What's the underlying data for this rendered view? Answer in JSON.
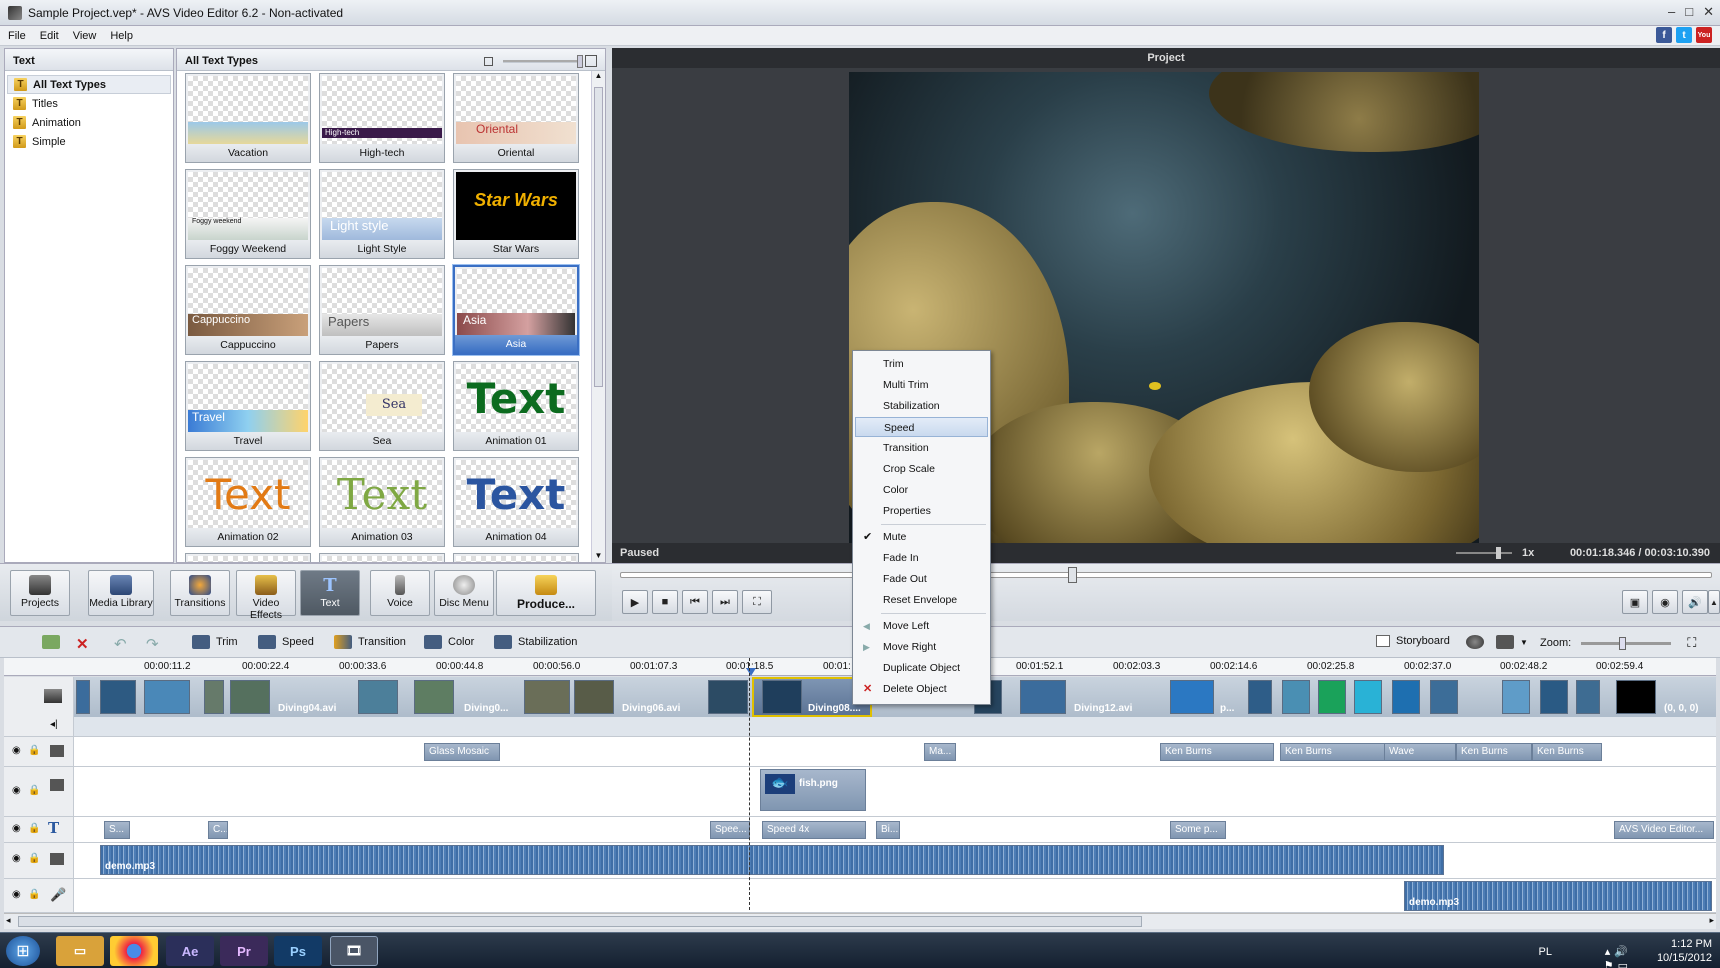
{
  "window": {
    "title": "Sample Project.vep* - AVS Video Editor 6.2 - Non-activated"
  },
  "menu": [
    "File",
    "Edit",
    "View",
    "Help"
  ],
  "social": [
    {
      "name": "facebook",
      "label": "f",
      "color": "#3b5998"
    },
    {
      "name": "twitter",
      "label": "t",
      "color": "#1da1f2"
    },
    {
      "name": "youtube",
      "label": "You",
      "color": "#cc2222"
    }
  ],
  "left_panel": {
    "title": "Text",
    "items": [
      {
        "label": "All Text Types",
        "selected": true
      },
      {
        "label": "Titles"
      },
      {
        "label": "Animation"
      },
      {
        "label": "Simple"
      }
    ]
  },
  "gallery": {
    "title": "All Text Types",
    "tiles": [
      {
        "label": "Vacation"
      },
      {
        "label": "High-tech",
        "text": "High-tech"
      },
      {
        "label": "Oriental",
        "text": "Oriental"
      },
      {
        "label": "Foggy Weekend",
        "text": "Foggy weekend"
      },
      {
        "label": "Light Style",
        "text": "Light style"
      },
      {
        "label": "Star Wars",
        "text": "Star Wars"
      },
      {
        "label": "Cappuccino",
        "text": "Cappuccino"
      },
      {
        "label": "Papers",
        "text": "Papers"
      },
      {
        "label": "Asia",
        "text": "Asia",
        "selected": true
      },
      {
        "label": "Travel",
        "text": "Travel"
      },
      {
        "label": "Sea",
        "text": "Sea"
      },
      {
        "label": "Animation 01",
        "text": "Text"
      },
      {
        "label": "Animation 02",
        "text": "Text"
      },
      {
        "label": "Animation 03",
        "text": "Text"
      },
      {
        "label": "Animation 04",
        "text": "Text"
      }
    ]
  },
  "preview": {
    "title": "Project",
    "status": "Paused",
    "speed": "1x",
    "time": "00:01:18.346 / 00:03:10.390",
    "progress": 0.41
  },
  "toolbar": {
    "buttons": [
      {
        "label": "Projects"
      },
      {
        "label": "Media Library"
      },
      {
        "label": "Transitions"
      },
      {
        "label": "Video Effects"
      },
      {
        "label": "Text",
        "active": true
      },
      {
        "label": "Voice"
      },
      {
        "label": "Disc Menu"
      },
      {
        "label": "Produce..."
      }
    ]
  },
  "timeline_toolbar": {
    "trim": "Trim",
    "speed": "Speed",
    "transition": "Transition",
    "color": "Color",
    "stabilization": "Stabilization",
    "storyboard": "Storyboard",
    "zoom": "Zoom:"
  },
  "ruler": [
    "00:00:11.2",
    "00:00:22.4",
    "00:00:33.6",
    "00:00:44.8",
    "00:00:56.0",
    "00:01:07.3",
    "00:01:18.5",
    "00:01:",
    "00:01:52.1",
    "00:02:03.3",
    "00:02:14.6",
    "00:02:25.8",
    "00:02:37.0",
    "00:02:48.2",
    "00:02:59.4"
  ],
  "video_track": {
    "labels": [
      "Diving04.avi",
      "Diving0...",
      "Diving06.avi",
      "Diving08....",
      "Diving12.avi",
      "p...",
      "(0, 0, 0)"
    ]
  },
  "effects_track": [
    "Glass Mosaic",
    "Ma...",
    "Ken Burns",
    "Ken Burns",
    "Wave",
    "Ken Burns",
    "Ken Burns"
  ],
  "overlay_track": {
    "clip": "fish.png"
  },
  "text_track": [
    "S...",
    "C...",
    "Spee...",
    "Speed 4x",
    "Bi...",
    "Some p...",
    "AVS Video Editor..."
  ],
  "audio": {
    "clip1": "demo.mp3",
    "clip2": "demo.mp3"
  },
  "context_menu": {
    "group1": [
      "Trim",
      "Multi Trim",
      "Stabilization",
      "Speed",
      "Transition",
      "Crop Scale",
      "Color",
      "Properties"
    ],
    "highlighted": "Speed",
    "group2": [
      "Mute",
      "Fade In",
      "Fade Out",
      "Reset Envelope"
    ],
    "group3": [
      "Move Left",
      "Move Right",
      "Duplicate Object",
      "Delete Object"
    ]
  },
  "taskbar": {
    "apps": [
      {
        "name": "explorer",
        "label": "",
        "color": "#d9a23a"
      },
      {
        "name": "chrome",
        "label": "",
        "color": "#cf3b30"
      },
      {
        "name": "after-effects",
        "label": "Ae",
        "color": "#2b2f5a"
      },
      {
        "name": "premiere",
        "label": "Pr",
        "color": "#3b2a5a"
      },
      {
        "name": "photoshop",
        "label": "Ps",
        "color": "#123a66"
      },
      {
        "name": "avs",
        "label": "",
        "color": "#4a5566"
      }
    ],
    "lang": "PL",
    "time": "1:12 PM",
    "date": "10/15/2012"
  }
}
